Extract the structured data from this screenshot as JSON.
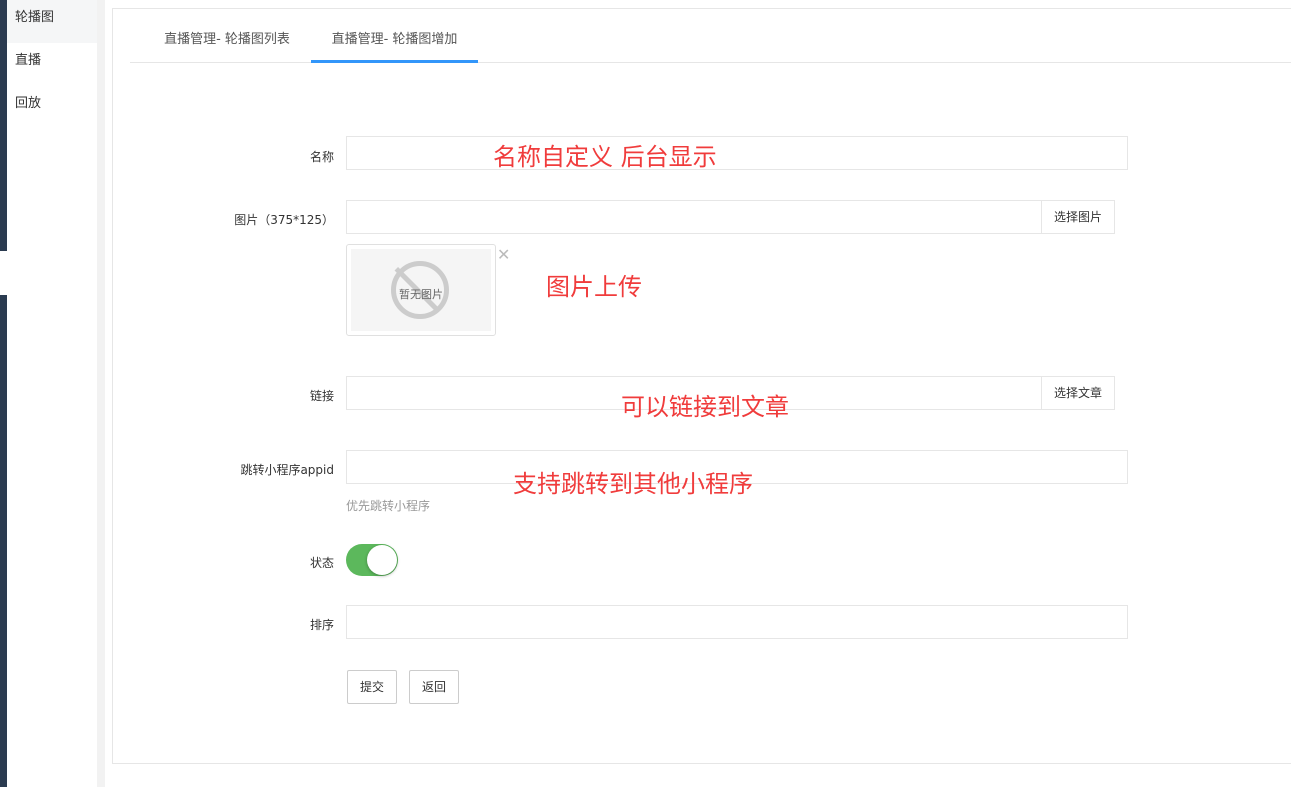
{
  "sidebar": {
    "items": [
      {
        "label": "轮播图"
      },
      {
        "label": "直播"
      },
      {
        "label": "回放"
      }
    ]
  },
  "tabs": [
    {
      "label": "直播管理- 轮播图列表"
    },
    {
      "label": "直播管理- 轮播图增加"
    }
  ],
  "form": {
    "name_label": "名称",
    "name_note": "名称自定义 后台显示",
    "image_label": "图片（375*125）",
    "image_button": "选择图片",
    "no_image": "暂无图片",
    "image_note": "图片上传",
    "close": "✕",
    "link_label": "链接",
    "link_button": "选择文章",
    "link_note": "可以链接到文章",
    "appid_label": "跳转小程序appid",
    "appid_note": "支持跳转到其他小程序",
    "appid_hint": "优先跳转小程序",
    "status_label": "状态",
    "status_on": true,
    "sort_label": "排序",
    "submit": "提交",
    "back": "返回"
  },
  "colors": {
    "accent": "#3296fa",
    "note": "#f03c3c",
    "toggle": "#5cb85c"
  }
}
